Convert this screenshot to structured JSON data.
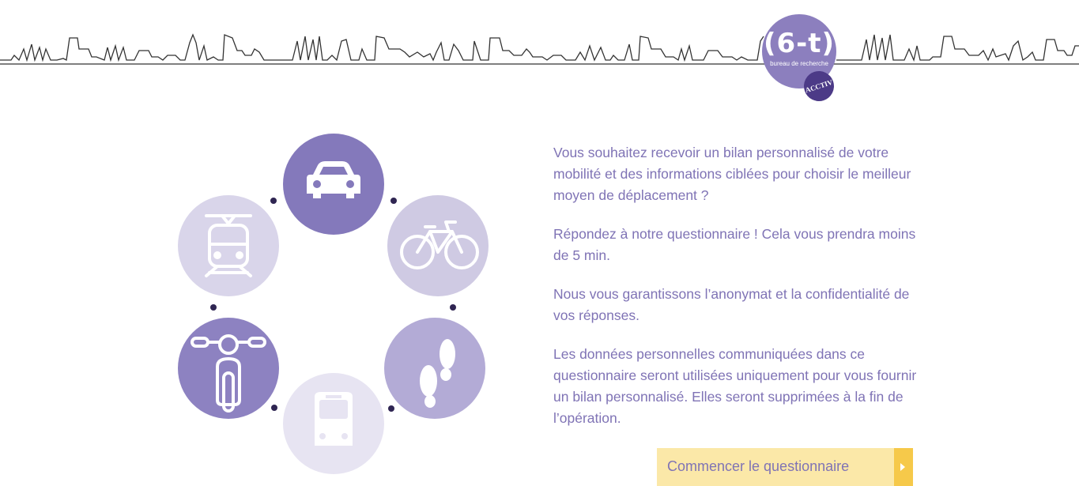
{
  "header": {
    "logo_text": "(6-t)",
    "logo_subtitle": "bureau de recherche",
    "badge_text": "ACCTIV"
  },
  "modes": [
    {
      "icon": "car-icon",
      "color": "#8479bb"
    },
    {
      "icon": "bike-icon",
      "color": "#cfcae3"
    },
    {
      "icon": "footprints-icon",
      "color": "#b3abd6"
    },
    {
      "icon": "bus-icon",
      "color": "#e7e4f2"
    },
    {
      "icon": "scooter-icon",
      "color": "#8d82c1"
    },
    {
      "icon": "tram-icon",
      "color": "#d9d5ea"
    }
  ],
  "intro": {
    "p1": "Vous souhaitez recevoir un bilan personnalisé de votre mobilité et des informations ciblées pour choisir le meilleur moyen de déplacement ?",
    "p2": "Répondez à notre questionnaire ! Cela vous prendra moins de 5 min.",
    "p3": "Nous vous garantissons l’anonymat et la confidentialité de vos réponses.",
    "p4": "Les données personnelles communiquées dans ce questionnaire seront utilisées uniquement pour vous fournir un bilan personnalisé. Elles seront supprimées à la fin de l’opération."
  },
  "cta": {
    "label": "Commencer le questionnaire"
  }
}
